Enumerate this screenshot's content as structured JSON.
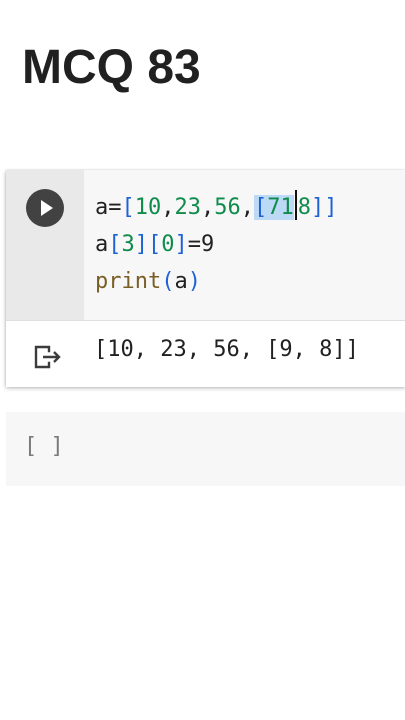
{
  "title": "MCQ 83",
  "cell1": {
    "run_icon": "play-circle-icon",
    "code": {
      "line1": {
        "prefix": "a=",
        "open_bracket": "[",
        "n1": "10",
        "n2": "23",
        "n3": "56",
        "inner_open": "[",
        "inner_selected": "71",
        "n5": "8",
        "close": "]]"
      },
      "line2": {
        "var": "a",
        "idx1_open": "[",
        "idx1": "3",
        "idx1_close": "]",
        "idx2_open": "[",
        "idx2": "0",
        "idx2_close": "]",
        "assign": "=9"
      },
      "line3": {
        "fn": "print",
        "paren_open": "(",
        "arg": "a",
        "paren_close": ")"
      }
    },
    "output_icon": "output-redirect-icon",
    "output": "[10, 23, 56, [9, 8]]"
  },
  "cell2": {
    "placeholder": "[ ]"
  },
  "colors": {
    "bracket": "#1e63d6",
    "number": "#0f8b4c",
    "function": "#795e26",
    "selection": "#bcd9f5"
  }
}
